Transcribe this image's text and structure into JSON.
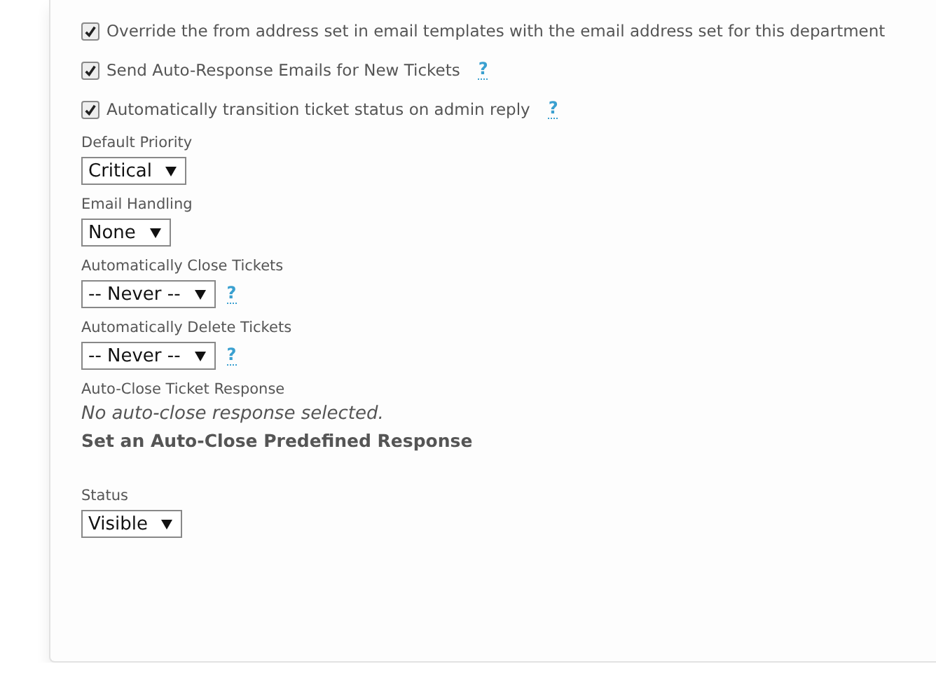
{
  "checkboxes": [
    {
      "label": "Override the from address set in email templates with the email address set for this department",
      "checked": true
    },
    {
      "label": "Send Auto-Response Emails for New Tickets",
      "checked": true,
      "help": "?"
    },
    {
      "label": "Automatically transition ticket status on admin reply",
      "checked": true,
      "help": "?"
    }
  ],
  "fields": [
    {
      "kind": "select",
      "label": "Default Priority",
      "value": "Critical"
    },
    {
      "kind": "select",
      "label": "Email Handling",
      "value": "None"
    },
    {
      "kind": "select",
      "label": "Automatically Close Tickets",
      "value": "-- Never --",
      "help": "?"
    },
    {
      "kind": "select",
      "label": "Automatically Delete Tickets",
      "value": "-- Never --",
      "help": "?"
    },
    {
      "kind": "response",
      "label": "Auto-Close Ticket Response",
      "note": "No auto-close response selected.",
      "link": "Set an Auto-Close Predefined Response"
    },
    {
      "kind": "select",
      "label": "Status",
      "value": "Visible"
    }
  ]
}
